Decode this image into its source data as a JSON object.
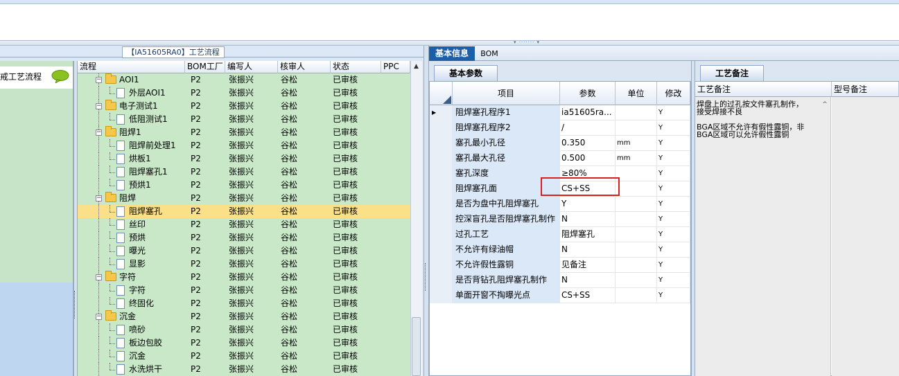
{
  "window": {
    "process_title": "【IA51605RA0】工艺流程"
  },
  "left_list": {
    "item_label": "戒工艺流程"
  },
  "tree": {
    "columns": [
      "流程",
      "BOM工厂",
      "编写人",
      "核审人",
      "状态",
      "PPC"
    ],
    "rows": [
      {
        "name": "AOI1",
        "level": 1,
        "type": "folder",
        "bom": "P2",
        "writer": "张振兴",
        "reviewer": "谷松",
        "status": "已审核"
      },
      {
        "name": "外层AOI1",
        "level": 2,
        "type": "doc",
        "bom": "P2",
        "writer": "张振兴",
        "reviewer": "谷松",
        "status": "已审核"
      },
      {
        "name": "电子测试1",
        "level": 1,
        "type": "folder",
        "bom": "P2",
        "writer": "张振兴",
        "reviewer": "谷松",
        "status": "已审核"
      },
      {
        "name": "低阻测试1",
        "level": 2,
        "type": "doc",
        "bom": "P2",
        "writer": "张振兴",
        "reviewer": "谷松",
        "status": "已审核"
      },
      {
        "name": "阻焊1",
        "level": 1,
        "type": "folder",
        "bom": "P2",
        "writer": "张振兴",
        "reviewer": "谷松",
        "status": "已审核"
      },
      {
        "name": "阻焊前处理1",
        "level": 2,
        "type": "doc",
        "bom": "P2",
        "writer": "张振兴",
        "reviewer": "谷松",
        "status": "已审核"
      },
      {
        "name": "烘板1",
        "level": 2,
        "type": "doc",
        "bom": "P2",
        "writer": "张振兴",
        "reviewer": "谷松",
        "status": "已审核"
      },
      {
        "name": "阻焊塞孔1",
        "level": 2,
        "type": "doc",
        "bom": "P2",
        "writer": "张振兴",
        "reviewer": "谷松",
        "status": "已审核"
      },
      {
        "name": "预烘1",
        "level": 2,
        "type": "doc",
        "bom": "P2",
        "writer": "张振兴",
        "reviewer": "谷松",
        "status": "已审核"
      },
      {
        "name": "阻焊",
        "level": 1,
        "type": "folder",
        "bom": "P2",
        "writer": "张振兴",
        "reviewer": "谷松",
        "status": "已审核"
      },
      {
        "name": "阻焊塞孔",
        "level": 2,
        "type": "doc",
        "bom": "P2",
        "writer": "张振兴",
        "reviewer": "谷松",
        "status": "已审核",
        "selected": true
      },
      {
        "name": "丝印",
        "level": 2,
        "type": "doc",
        "bom": "P2",
        "writer": "张振兴",
        "reviewer": "谷松",
        "status": "已审核"
      },
      {
        "name": "预烘",
        "level": 2,
        "type": "doc",
        "bom": "P2",
        "writer": "张振兴",
        "reviewer": "谷松",
        "status": "已审核"
      },
      {
        "name": "曝光",
        "level": 2,
        "type": "doc",
        "bom": "P2",
        "writer": "张振兴",
        "reviewer": "谷松",
        "status": "已审核"
      },
      {
        "name": "显影",
        "level": 2,
        "type": "doc",
        "bom": "P2",
        "writer": "张振兴",
        "reviewer": "谷松",
        "status": "已审核"
      },
      {
        "name": "字符",
        "level": 1,
        "type": "folder",
        "bom": "P2",
        "writer": "张振兴",
        "reviewer": "谷松",
        "status": "已审核"
      },
      {
        "name": "字符",
        "level": 2,
        "type": "doc",
        "bom": "P2",
        "writer": "张振兴",
        "reviewer": "谷松",
        "status": "已审核"
      },
      {
        "name": "终固化",
        "level": 2,
        "type": "doc",
        "bom": "P2",
        "writer": "张振兴",
        "reviewer": "谷松",
        "status": "已审核"
      },
      {
        "name": "沉金",
        "level": 1,
        "type": "folder",
        "bom": "P2",
        "writer": "张振兴",
        "reviewer": "谷松",
        "status": "已审核"
      },
      {
        "name": "喷砂",
        "level": 2,
        "type": "doc",
        "bom": "P2",
        "writer": "张振兴",
        "reviewer": "谷松",
        "status": "已审核"
      },
      {
        "name": "板边包胶",
        "level": 2,
        "type": "doc",
        "bom": "P2",
        "writer": "张振兴",
        "reviewer": "谷松",
        "status": "已审核"
      },
      {
        "name": "沉金",
        "level": 2,
        "type": "doc",
        "bom": "P2",
        "writer": "张振兴",
        "reviewer": "谷松",
        "status": "已审核"
      },
      {
        "name": "水洗烘干",
        "level": 2,
        "type": "doc",
        "bom": "P2",
        "writer": "张振兴",
        "reviewer": "谷松",
        "status": "已审核"
      }
    ]
  },
  "tabs": {
    "basic": "基本信息",
    "bom": "BOM"
  },
  "basic_params": {
    "tab_label": "基本参数",
    "columns": [
      "项目",
      "参数",
      "单位",
      "修改"
    ],
    "rows": [
      {
        "item": "阻焊塞孔程序1",
        "param": "ia51605ra...",
        "unit": "",
        "mod": "Y",
        "current": true
      },
      {
        "item": "阻焊塞孔程序2",
        "param": "/",
        "unit": "",
        "mod": "Y"
      },
      {
        "item": "塞孔最小孔径",
        "param": "0.350",
        "unit": "mm",
        "mod": "Y"
      },
      {
        "item": "塞孔最大孔径",
        "param": "0.500",
        "unit": "mm",
        "mod": "Y"
      },
      {
        "item": "塞孔深度",
        "param": "≥80%",
        "unit": "",
        "mod": "Y"
      },
      {
        "item": "阻焊塞孔面",
        "param": "CS+SS",
        "unit": "",
        "mod": "Y"
      },
      {
        "item": "是否为盘中孔阻焊塞孔",
        "param": "Y",
        "unit": "",
        "mod": "Y"
      },
      {
        "item": "控深盲孔是否阻焊塞孔制作",
        "param": "N",
        "unit": "",
        "mod": "Y"
      },
      {
        "item": "过孔工艺",
        "param": "阻焊塞孔",
        "unit": "",
        "mod": "Y"
      },
      {
        "item": "不允许有绿油帽",
        "param": "N",
        "unit": "",
        "mod": "Y"
      },
      {
        "item": "不允许假性露铜",
        "param": "见备注",
        "unit": "",
        "mod": "Y"
      },
      {
        "item": "是否背钻孔阻焊塞孔制作",
        "param": "N",
        "unit": "",
        "mod": "Y"
      },
      {
        "item": "单面开窗不掏曝光点",
        "param": "CS+SS",
        "unit": "",
        "mod": "Y"
      }
    ]
  },
  "craft_notes": {
    "tab_label": "工艺备注",
    "columns": [
      "工艺备注",
      "型号备注"
    ],
    "note": "焊盘上的过孔按文件塞孔制作，\n接受焊接不良\n\nBGA区域不允许有假性露铜，非\nBGA区域可以允许假性露铜"
  },
  "colors": {
    "tree_bg": "#c8e8c8",
    "selected_row": "#fbe08a",
    "active_tab": "#1c5ea8",
    "highlight_box": "#d91e1e"
  }
}
